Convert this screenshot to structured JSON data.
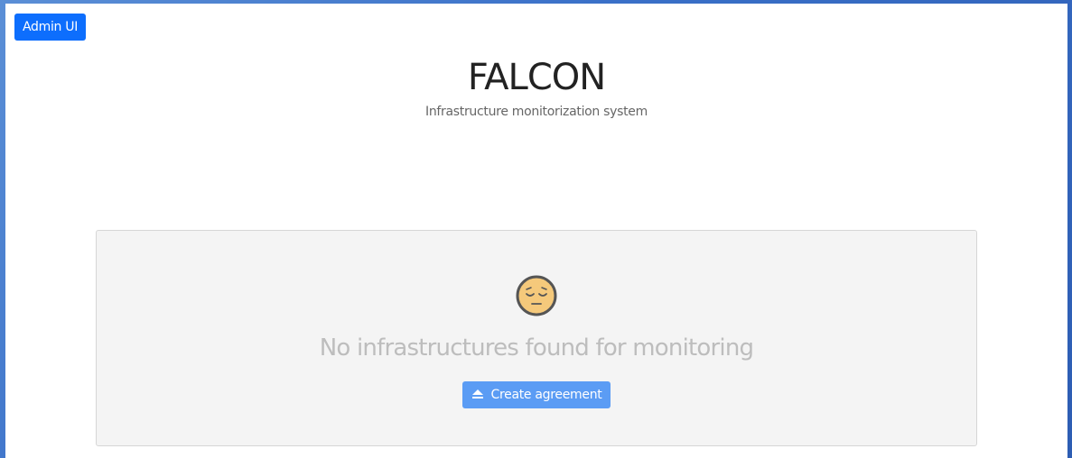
{
  "header": {
    "admin_button_label": "Admin UI",
    "title": "FALCON",
    "subtitle": "Infrastructure monitorization system"
  },
  "empty_state": {
    "icon": "sad-face-icon",
    "message": "No infrastructures found for monitoring",
    "action_icon": "eject-icon",
    "action_label": "Create agreement"
  },
  "colors": {
    "admin_button": "#0d6efd",
    "action_button": "#5b9cf4",
    "panel_background": "#f4f4f4",
    "face": "#f5c97b"
  }
}
